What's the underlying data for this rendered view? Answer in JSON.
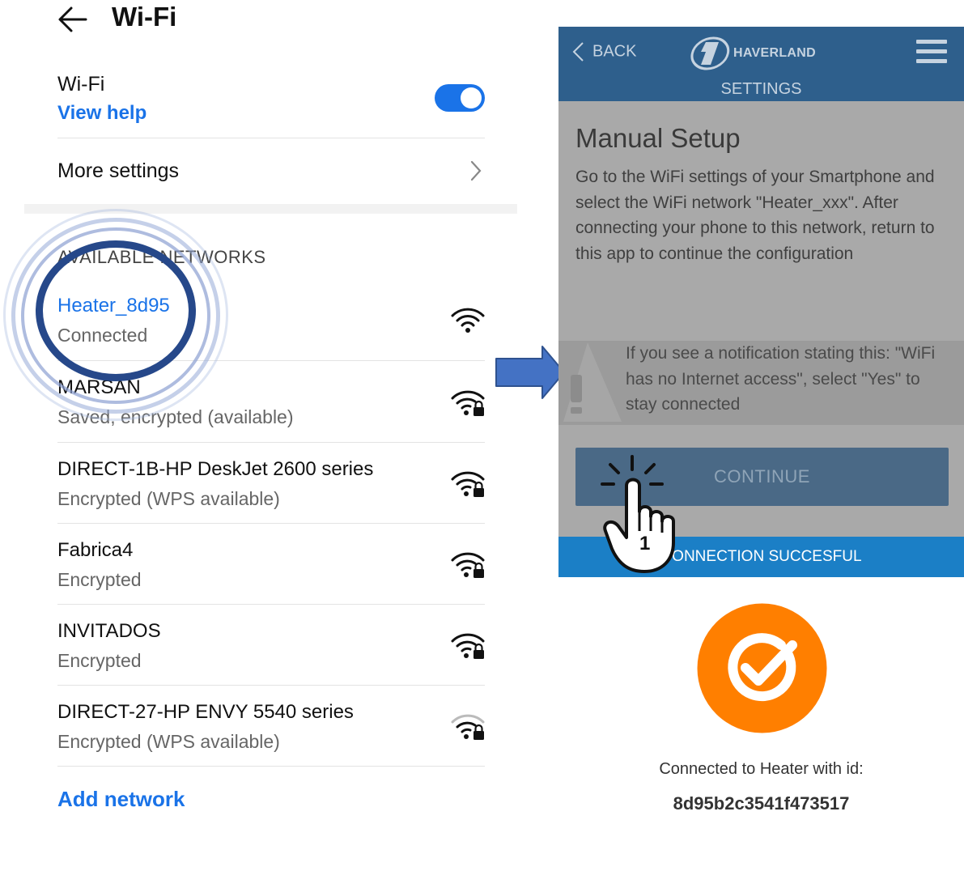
{
  "wifi_screen": {
    "title": "Wi-Fi",
    "wifi_label": "Wi-Fi",
    "view_help": "View help",
    "toggle_on": true,
    "more_settings": "More settings",
    "section_header": "AVAILABLE NETWORKS",
    "networks": [
      {
        "name": "Heater_8d95",
        "status": "Connected",
        "secured": false
      },
      {
        "name": "MARSAN",
        "status": "Saved, encrypted (available)",
        "secured": true
      },
      {
        "name": "DIRECT-1B-HP DeskJet 2600 series",
        "status": "Encrypted (WPS available)",
        "secured": true
      },
      {
        "name": "Fabrica4",
        "status": "Encrypted",
        "secured": true
      },
      {
        "name": "INVITADOS",
        "status": "Encrypted",
        "secured": true
      },
      {
        "name": "DIRECT-27-HP ENVY 5540 series",
        "status": "Encrypted (WPS available)",
        "secured": true
      }
    ],
    "add_network": "Add network",
    "accent_color": "#1a73e8"
  },
  "app_screen": {
    "back_label": "BACK",
    "brand": "HAVERLAND",
    "subtitle": "SETTINGS",
    "manual_title": "Manual Setup",
    "manual_body": "Go to the WiFi settings of your Smartphone and select the WiFi network \"Heater_xxx\". After connecting your phone to this network, return to this app to continue the configuration",
    "warning_text": "If you see a notification stating this: \"WiFi has no Internet access\", select \"Yes\" to stay connected",
    "continue_label": "CONTINUE",
    "connection_bar": "CONNECTION SUCCESFUL",
    "tap_step": "1",
    "connected_text": "Connected to Heater with id:",
    "heater_id": "8d95b2c3541f473517",
    "header_color": "#2e5f8c",
    "success_color": "#ff7f00"
  }
}
